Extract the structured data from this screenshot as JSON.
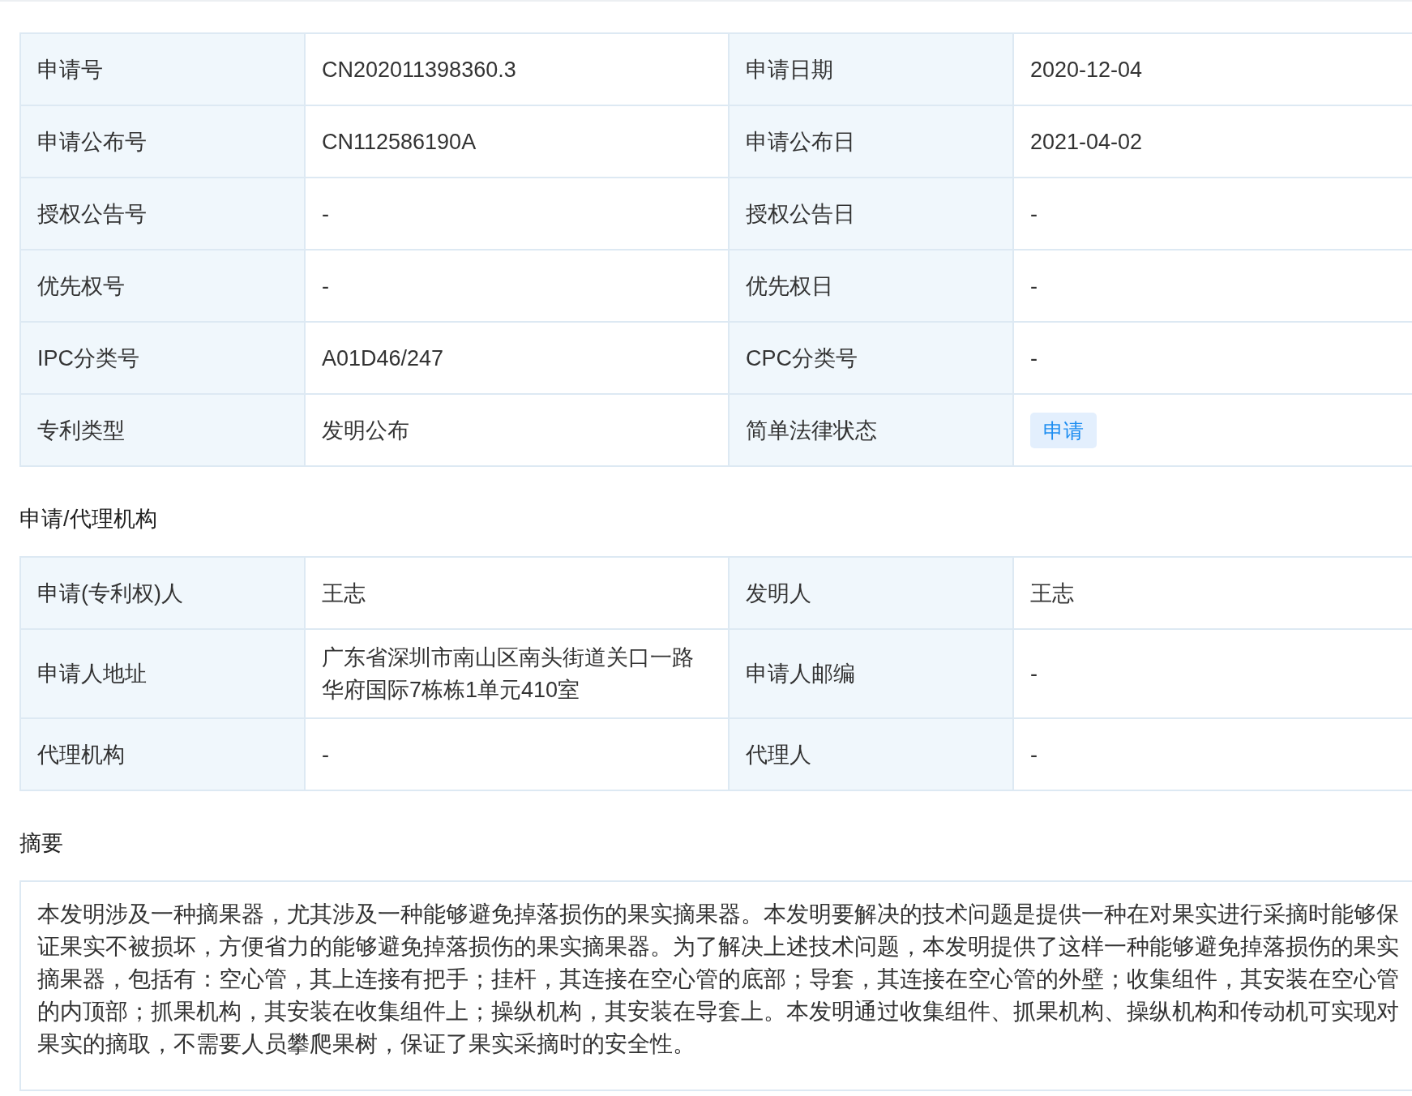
{
  "basic_info": {
    "rows": [
      {
        "fields": [
          {
            "label": "申请号",
            "value": "CN202011398360.3",
            "kind": "text"
          },
          {
            "label": "申请日期",
            "value": "2020-12-04",
            "kind": "text"
          }
        ]
      },
      {
        "fields": [
          {
            "label": "申请公布号",
            "value": "CN112586190A",
            "kind": "text"
          },
          {
            "label": "申请公布日",
            "value": "2021-04-02",
            "kind": "text"
          }
        ]
      },
      {
        "fields": [
          {
            "label": "授权公告号",
            "value": "-",
            "kind": "text"
          },
          {
            "label": "授权公告日",
            "value": "-",
            "kind": "text"
          }
        ]
      },
      {
        "fields": [
          {
            "label": "优先权号",
            "value": "-",
            "kind": "text"
          },
          {
            "label": "优先权日",
            "value": "-",
            "kind": "text"
          }
        ]
      },
      {
        "fields": [
          {
            "label": "IPC分类号",
            "value": "A01D46/247",
            "kind": "text"
          },
          {
            "label": "CPC分类号",
            "value": "-",
            "kind": "text"
          }
        ]
      },
      {
        "fields": [
          {
            "label": "专利类型",
            "value": "发明公布",
            "kind": "text"
          },
          {
            "label": "简单法律状态",
            "value": "申请",
            "kind": "tag"
          }
        ]
      }
    ]
  },
  "agency": {
    "title": "申请/代理机构",
    "rows": [
      {
        "fields": [
          {
            "label": "申请(专利权)人",
            "value": "王志",
            "kind": "text"
          },
          {
            "label": "发明人",
            "value": "王志",
            "kind": "text"
          }
        ]
      },
      {
        "fields": [
          {
            "label": "申请人地址",
            "value": "广东省深圳市南山区南头街道关口一路华府国际7栋栋1单元410室",
            "kind": "text"
          },
          {
            "label": "申请人邮编",
            "value": "-",
            "kind": "text"
          }
        ]
      },
      {
        "fields": [
          {
            "label": "代理机构",
            "value": "-",
            "kind": "text"
          },
          {
            "label": "代理人",
            "value": "-",
            "kind": "text"
          }
        ]
      }
    ]
  },
  "abstract": {
    "title": "摘要",
    "text": "本发明涉及一种摘果器，尤其涉及一种能够避免掉落损伤的果实摘果器。本发明要解决的技术问题是提供一种在对果实进行采摘时能够保证果实不被损坏，方便省力的能够避免掉落损伤的果实摘果器。为了解决上述技术问题，本发明提供了这样一种能够避免掉落损伤的果实摘果器，包括有：空心管，其上连接有把手；挂杆，其连接在空心管的底部；导套，其连接在空心管的外壁；收集组件，其安装在空心管的内顶部；抓果机构，其安装在收集组件上；操纵机构，其安装在导套上。本发明通过收集组件、抓果机构、操纵机构和传动机可实现对果实的摘取，不需要人员攀爬果树，保证了果实采摘时的安全性。"
  }
}
